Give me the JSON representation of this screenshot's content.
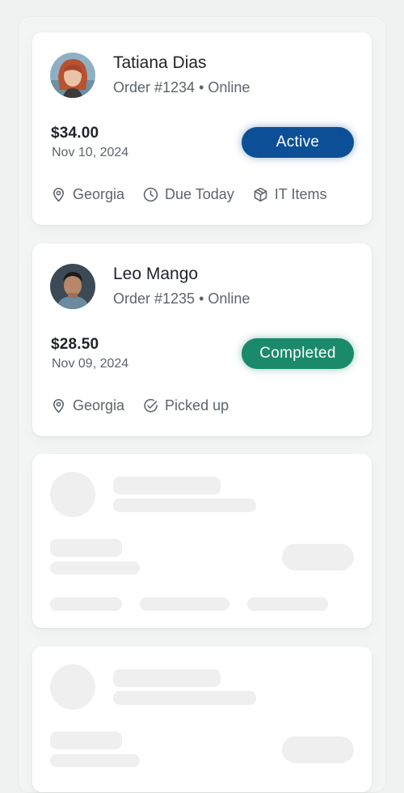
{
  "orders": [
    {
      "customer_name": "Tatiana Dias",
      "order_line": "Order #1234 • Online",
      "price": "$34.00",
      "date": "Nov 10, 2024",
      "status": "Active",
      "status_color": "#0d4f96",
      "meta": [
        {
          "icon": "location-pin-icon",
          "label": "Georgia"
        },
        {
          "icon": "clock-icon",
          "label": "Due Today"
        },
        {
          "icon": "package-icon",
          "label": "IT Items"
        }
      ]
    },
    {
      "customer_name": "Leo Mango",
      "order_line": "Order #1235 • Online",
      "price": "$28.50",
      "date": "Nov 09, 2024",
      "status": "Completed",
      "status_color": "#1b8a6b",
      "meta": [
        {
          "icon": "location-pin-icon",
          "label": "Georgia"
        },
        {
          "icon": "check-circle-icon",
          "label": "Picked up"
        }
      ]
    }
  ]
}
